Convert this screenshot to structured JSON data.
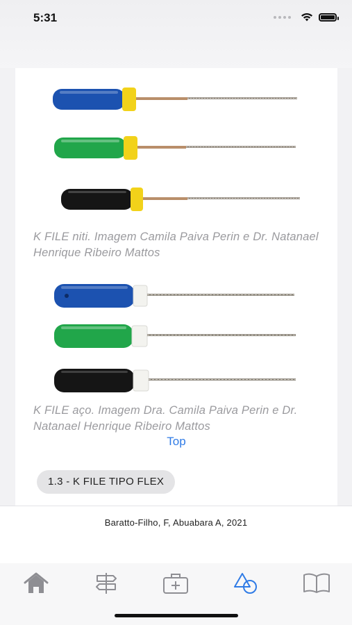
{
  "status": {
    "time": "5:31"
  },
  "content": {
    "caption1": "K FILE niti. Imagem Camila Paiva Perin e Dr. Natanael Henrique Ribeiro Mattos",
    "caption2": "K FILE aço. Imagem Dra. Camila Paiva Perin e Dr. Natanael Henrique Ribeiro Mattos",
    "top_link": "Top",
    "section_pill": "1.3 - K FILE TIPO FLEX"
  },
  "footer": {
    "credit": "Baratto-Filho, F, Abuabara A, 2021"
  },
  "tabs": [
    {
      "icon": "home-icon",
      "active": false
    },
    {
      "icon": "signpost-icon",
      "active": false
    },
    {
      "icon": "medical-kit-icon",
      "active": false
    },
    {
      "icon": "shapes-icon",
      "active": true
    },
    {
      "icon": "book-icon",
      "active": false
    }
  ],
  "colors": {
    "accent": "#2f7be6",
    "inactive": "#8e8e93"
  },
  "images": {
    "group1": [
      {
        "handle": "#1c52b0",
        "collar": "#f2d21a"
      },
      {
        "handle": "#21a64a",
        "collar": "#f2d21a"
      },
      {
        "handle": "#151515",
        "collar": "#f2d21a"
      }
    ],
    "group2": [
      {
        "handle": "#1c52b0",
        "collar": "#f3f3ef"
      },
      {
        "handle": "#21a64a",
        "collar": "#f3f3ef"
      },
      {
        "handle": "#151515",
        "collar": "#f3f3ef"
      }
    ]
  }
}
